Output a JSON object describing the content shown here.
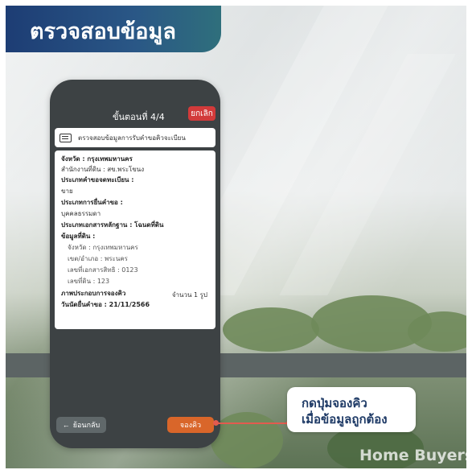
{
  "title": "ตรวจสอบข้อมูล",
  "phone": {
    "step": "ขั้นตอนที่ 4/4",
    "cancel_label": "ยกเลิก",
    "header": "ตรวจสอบข้อมูลการรับคำขอคิวจะเบียน",
    "rows": {
      "province": "จังหวัด : กรุงเทพมหานคร",
      "office": "สำนักงานที่ดิน : สข.พระโขนง",
      "reg_type_label": "ประเภทคำขอจดทะเบียน :",
      "reg_type_value": "ขาย",
      "applicant_type_label": "ประเภทการยื่นคำขอ :",
      "applicant_type_value": "บุคคลธรรมดา",
      "doc_type": "ประเภทเอกสารหลักฐาน : โฉนดที่ดิน",
      "land_info_label": "ข้อมูลที่ดิน :",
      "land_province": "จังหวัด : กรุงเทพมหานคร",
      "land_district": "เขต/อำเภอ : พระนคร",
      "doc_no": "เลขที่เอกสารสิทธิ : 0123",
      "land_no": "เลขที่ดิน : 123",
      "photos_label": "ภาพประกอบการจองคิว",
      "photos_count": "จำนวน 1 รูป",
      "date": "วันนัดยื่นคำขอ : 21/11/2566"
    },
    "back_label": "ย้อนกลับ",
    "back_icon": "←",
    "book_label": "จองคิว"
  },
  "callout": {
    "line1": "กดปุ่มจองคิว",
    "line2": "เมื่อข้อมูลถูกต้อง"
  },
  "watermark": "Home Buyers",
  "colors": {
    "accent_orange": "#d9662a",
    "cancel_red": "#d23a3a",
    "title_blue": "#1d3d74",
    "callout_line": "#e35b4f"
  }
}
